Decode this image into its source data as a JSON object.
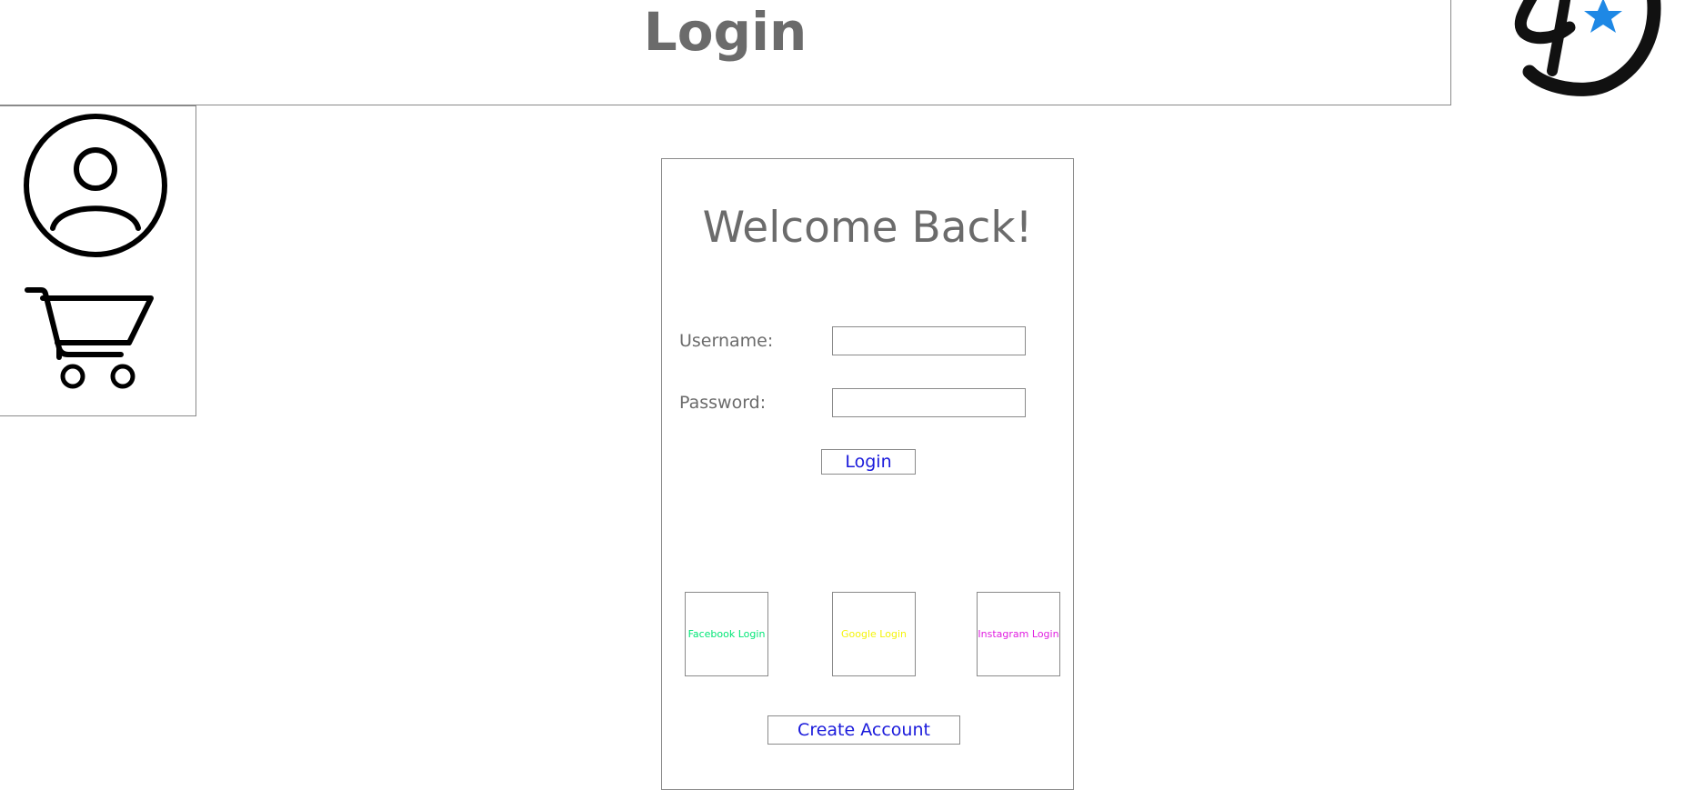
{
  "header": {
    "title": "Login"
  },
  "logo": {
    "name": "brand-logo",
    "accent_color": "#1e88e5"
  },
  "sidebar": {
    "items": [
      {
        "name": "profile",
        "icon": "user-circle-icon"
      },
      {
        "name": "cart",
        "icon": "shopping-cart-icon"
      }
    ]
  },
  "login_form": {
    "heading": "Welcome Back!",
    "username_label": "Username:",
    "username_value": "",
    "password_label": "Password:",
    "password_value": "",
    "login_button": "Login",
    "social": {
      "facebook": {
        "label": "Facebook Login",
        "color": "#00e676"
      },
      "google": {
        "label": "Google Login",
        "color": "#f4f40a"
      },
      "instagram": {
        "label": "Instagram Login",
        "color": "#e01ee0"
      }
    },
    "create_account_button": "Create Account"
  },
  "colors": {
    "link_blue": "#1a1adb",
    "text_gray": "#6b6b6b",
    "border_gray": "#8a8a8a"
  }
}
